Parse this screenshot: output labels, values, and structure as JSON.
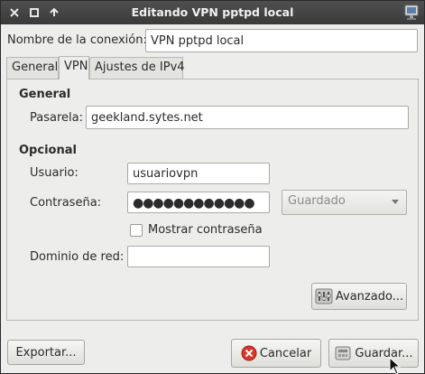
{
  "window": {
    "title": "Editando VPN pptpd local",
    "controls": [
      "close-icon",
      "maximize-icon",
      "shade-icon"
    ]
  },
  "connection_name": {
    "label": "Nombre de la conexión:",
    "value": "VPN pptpd local"
  },
  "tabs": [
    {
      "label": "General",
      "active": false
    },
    {
      "label": "VPN",
      "active": true
    },
    {
      "label": "Ajustes de IPv4",
      "active": false
    }
  ],
  "general": {
    "heading": "General",
    "gateway": {
      "label": "Pasarela:",
      "value": "geekland.sytes.net"
    }
  },
  "optional": {
    "heading": "Opcional",
    "user": {
      "label": "Usuario:",
      "value": "usuariovpn"
    },
    "password": {
      "label": "Contraseña:",
      "value": "●●●●●●●●●●●●",
      "store_option": "Guardado"
    },
    "show_password": {
      "label": "Mostrar contraseña",
      "checked": false
    },
    "domain": {
      "label": "Dominio de red:",
      "value": ""
    }
  },
  "advanced_button": {
    "label": "Avanzado..."
  },
  "footer": {
    "export_label": "Exportar...",
    "cancel_label": "Cancelar",
    "save_label": "Guardar..."
  },
  "colors": {
    "titlebar": "#3f3f3f",
    "cancel_icon": "#d8372a"
  }
}
